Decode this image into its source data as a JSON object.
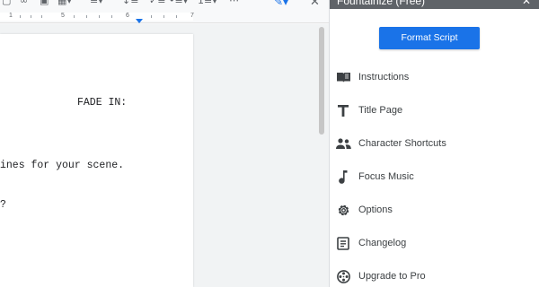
{
  "sidebar": {
    "title": "Fountainize (Free)",
    "format_button": "Format Script",
    "items": [
      {
        "label": "Instructions",
        "icon": "book-icon"
      },
      {
        "label": "Title Page",
        "icon": "text-t-icon"
      },
      {
        "label": "Character Shortcuts",
        "icon": "people-icon"
      },
      {
        "label": "Focus Music",
        "icon": "music-note-icon"
      },
      {
        "label": "Options",
        "icon": "gear-icon"
      },
      {
        "label": "Changelog",
        "icon": "document-icon"
      },
      {
        "label": "Upgrade to Pro",
        "icon": "film-reel-icon"
      }
    ]
  },
  "ruler": {
    "labels": [
      "1",
      "5",
      "6",
      "7"
    ]
  },
  "document": {
    "lines": [
      "FADE IN:",
      "ines for your scene.",
      "?"
    ]
  },
  "colors": {
    "accent": "#1a73e8",
    "sidebar_header": "#5f6368"
  }
}
